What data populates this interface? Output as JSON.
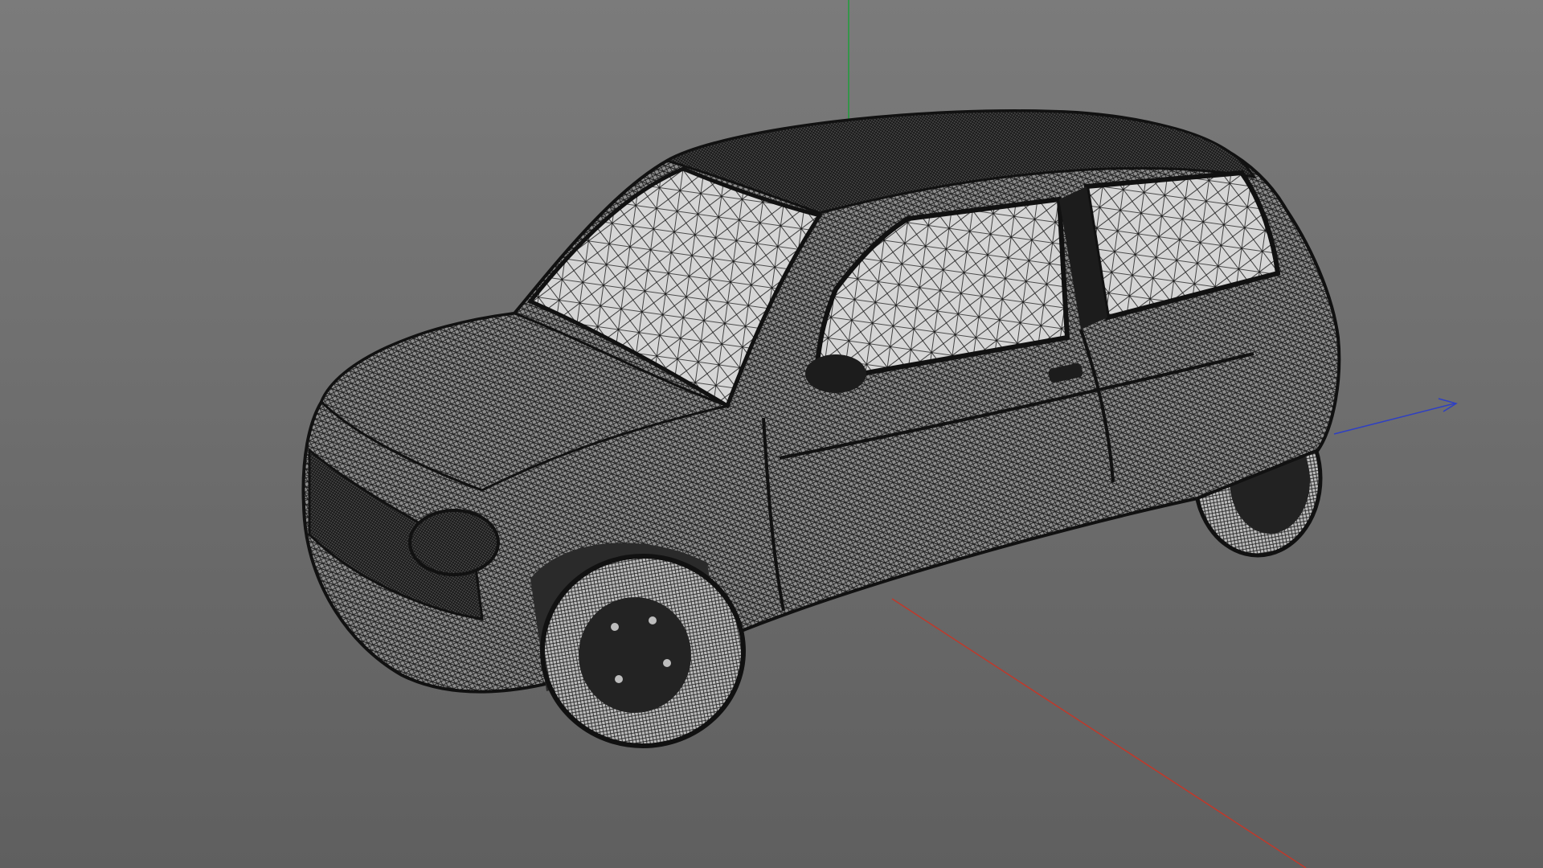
{
  "viewport": {
    "background_top": "#7b7b7b",
    "background_bottom": "#5f5f5f",
    "mesh_color": "#1c1c1c",
    "glass_color": "#cfcfcf",
    "body_color": "#9a9a9a"
  },
  "axes": {
    "x_color": "#c0392b",
    "y_color": "#1f9e3a",
    "z_color": "#2e3fc4"
  },
  "model": {
    "name": "car-hatchback",
    "display_mode": "wireframe"
  }
}
